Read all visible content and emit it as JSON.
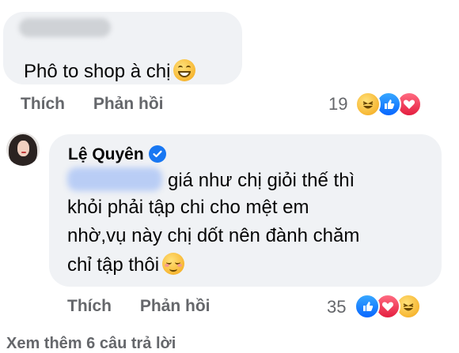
{
  "comment1": {
    "text": "Phô to shop à chị",
    "emoji": "grinning-face-with-smiling-eyes-emoji",
    "actions": {
      "like": "Thích",
      "reply": "Phản hồi"
    },
    "reaction_count": "19",
    "reactions": [
      "haha",
      "like",
      "love"
    ]
  },
  "comment2": {
    "author": "Lệ Quyên",
    "verified_icon": "verified-badge-icon",
    "lines": [
      "giá như chị giỏi thế thì",
      "khỏi phải tập chi cho mệt em",
      "nhờ,vụ này chị dốt nên đành chăm",
      "chỉ tập thôi"
    ],
    "emoji": "smiling-face-emoji",
    "actions": {
      "like": "Thích",
      "reply": "Phản hồi"
    },
    "reaction_count": "35",
    "reactions": [
      "like",
      "love",
      "haha"
    ]
  },
  "more_replies": "Xem thêm 6 câu trả lời",
  "colors": {
    "bubble": "#f0f2f5",
    "secondary_text": "#65676b",
    "like_blue": "#0866ff",
    "love_red": "#e41e3f",
    "verified_blue": "#1877f2"
  }
}
